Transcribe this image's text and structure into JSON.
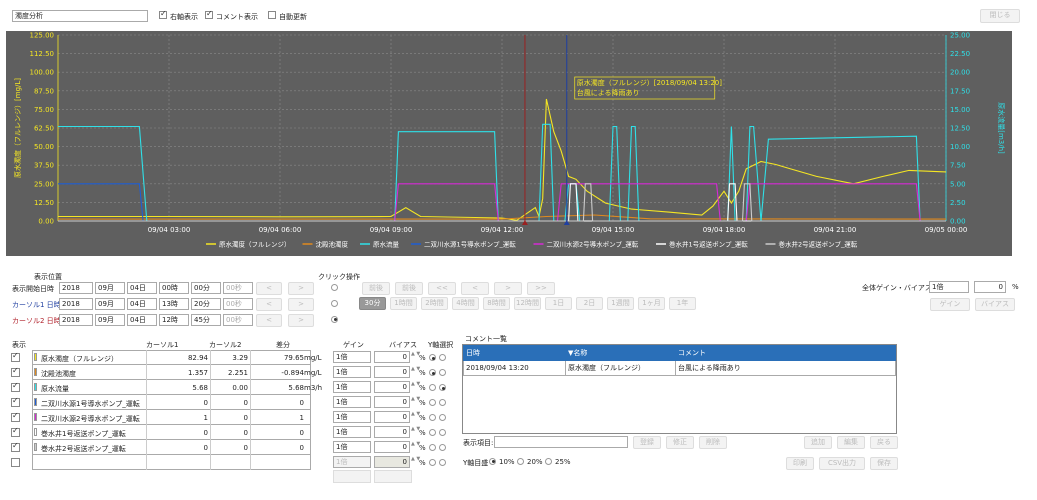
{
  "top": {
    "title_value": "濁度分析",
    "opt_right_axis": "右軸表示",
    "opt_comment": "コメント表示",
    "opt_autoupdate": "自動更新",
    "btn_close": "閉じる"
  },
  "chart_data": {
    "type": "line",
    "ylabel_left": "原水濁度（フルレンジ）[mg/L]",
    "ylabel_right": "原水流量[m3/h]",
    "y_left_ticks": [
      "125.00",
      "112.50",
      "100.00",
      "87.50",
      "75.00",
      "62.50",
      "50.00",
      "37.50",
      "25.00",
      "12.50",
      "0.00"
    ],
    "y_right_ticks": [
      "25.00",
      "22.50",
      "20.00",
      "17.50",
      "15.00",
      "12.50",
      "10.00",
      "7.50",
      "5.00",
      "2.50",
      "0.00"
    ],
    "ylim_left": [
      0,
      125
    ],
    "ylim_right": [
      0,
      25
    ],
    "x_ticks": [
      "09/04 03:00",
      "09/04 06:00",
      "09/04 09:00",
      "09/04 12:00",
      "09/04 15:00",
      "09/04 18:00",
      "09/04 21:00",
      "09/05 00:00"
    ],
    "xlim_hours": [
      0,
      24
    ],
    "annotation": {
      "line1": "原水濁度（フルレンジ）[2018/09/04 13:20]",
      "line2": "台風による降雨あり"
    },
    "cursor1_hour": 12.62,
    "cursor2_hour": 13.75,
    "series": [
      {
        "name": "原水濁度（フルレンジ）",
        "color": "#f5e623",
        "axis": "left",
        "points": [
          [
            0,
            3
          ],
          [
            3,
            3
          ],
          [
            6,
            2.8
          ],
          [
            8,
            2.9
          ],
          [
            9,
            3
          ],
          [
            9.4,
            9
          ],
          [
            9.8,
            3
          ],
          [
            12,
            2
          ],
          [
            12.4,
            0.5
          ],
          [
            12.9,
            9
          ],
          [
            13,
            3
          ],
          [
            13.1,
            15
          ],
          [
            13.2,
            82
          ],
          [
            13.4,
            60
          ],
          [
            13.6,
            47
          ],
          [
            13.8,
            30
          ],
          [
            14,
            28
          ],
          [
            14.3,
            20
          ],
          [
            14.8,
            12
          ],
          [
            15.5,
            8
          ],
          [
            16.5,
            6
          ],
          [
            17.4,
            4
          ],
          [
            17.7,
            10
          ],
          [
            18,
            20
          ],
          [
            18.2,
            12
          ],
          [
            18.4,
            20
          ],
          [
            18.6,
            35
          ],
          [
            19,
            40
          ],
          [
            19.4,
            38
          ],
          [
            19.8,
            35
          ],
          [
            20.5,
            30
          ],
          [
            21.5,
            25
          ],
          [
            22.3,
            30
          ],
          [
            23,
            34
          ],
          [
            24,
            33
          ]
        ]
      },
      {
        "name": "沈殿池濁度",
        "color": "#e08a1e",
        "axis": "left",
        "points": [
          [
            0,
            1.3
          ],
          [
            12,
            1.3
          ],
          [
            13.2,
            3
          ],
          [
            14.5,
            4
          ],
          [
            16,
            1.5
          ],
          [
            24,
            1.3
          ]
        ]
      },
      {
        "name": "原水流量",
        "color": "#2fe0e8",
        "axis": "right",
        "points": [
          [
            0,
            12.7
          ],
          [
            2.2,
            12.7
          ],
          [
            2.4,
            0
          ],
          [
            9.1,
            0
          ],
          [
            9.2,
            12
          ],
          [
            11.8,
            12
          ],
          [
            11.9,
            0
          ],
          [
            13,
            0
          ],
          [
            13.1,
            13
          ],
          [
            13.3,
            13
          ],
          [
            13.4,
            0
          ],
          [
            13.7,
            0
          ],
          [
            13.8,
            5
          ],
          [
            14,
            5
          ],
          [
            14.1,
            0
          ],
          [
            14.9,
            0
          ],
          [
            15,
            12.7
          ],
          [
            15.1,
            12.7
          ],
          [
            15.2,
            0
          ],
          [
            15.4,
            0
          ],
          [
            15.5,
            12.7
          ],
          [
            15.6,
            12.7
          ],
          [
            15.7,
            0
          ],
          [
            18.1,
            0
          ],
          [
            18.2,
            12.7
          ],
          [
            18.3,
            0
          ],
          [
            18.6,
            0
          ],
          [
            18.7,
            12.7
          ],
          [
            18.8,
            12.7
          ],
          [
            19,
            0
          ],
          [
            19.2,
            11
          ],
          [
            23.2,
            11.4
          ],
          [
            23.3,
            0
          ],
          [
            24,
            0
          ]
        ]
      },
      {
        "name": "二双川水源1号導水ポンプ_運転",
        "color": "#1f5fd4",
        "axis": "left",
        "points": [
          [
            0,
            25
          ],
          [
            2.2,
            25
          ],
          [
            2.3,
            0
          ],
          [
            24,
            0
          ]
        ]
      },
      {
        "name": "二双川水源2号導水ポンプ_運転",
        "color": "#d62ad6",
        "axis": "left",
        "points": [
          [
            0,
            0
          ],
          [
            9.1,
            0
          ],
          [
            9.2,
            25
          ],
          [
            11.8,
            25
          ],
          [
            11.9,
            0
          ],
          [
            13.5,
            0
          ],
          [
            13.6,
            25
          ],
          [
            17.8,
            25
          ],
          [
            17.9,
            0
          ],
          [
            18.6,
            0
          ],
          [
            18.7,
            25
          ],
          [
            23.2,
            25
          ],
          [
            23.3,
            0
          ],
          [
            24,
            0
          ]
        ]
      },
      {
        "name": "巻水井1号返送ポンプ_運転",
        "color": "#ffffff",
        "axis": "left",
        "points": [
          [
            0,
            0
          ],
          [
            13.8,
            0
          ],
          [
            13.85,
            25
          ],
          [
            14,
            25
          ],
          [
            14.05,
            0
          ],
          [
            18.1,
            0
          ],
          [
            18.15,
            25
          ],
          [
            18.3,
            25
          ],
          [
            18.35,
            0
          ],
          [
            24,
            0
          ]
        ]
      },
      {
        "name": "巻水井2号返送ポンプ_運転",
        "color": "#cccccc",
        "axis": "left",
        "points": [
          [
            0,
            0
          ],
          [
            14.2,
            0
          ],
          [
            14.25,
            25
          ],
          [
            14.4,
            25
          ],
          [
            14.45,
            0
          ],
          [
            18.5,
            0
          ],
          [
            18.55,
            25
          ],
          [
            18.7,
            25
          ],
          [
            18.75,
            0
          ],
          [
            24,
            0
          ]
        ]
      }
    ]
  },
  "controls": {
    "pos_label": "表示位置",
    "click_label": "クリック操作",
    "start_label": "表示開始日時",
    "cursor1_label": "カーソル1 日時",
    "cursor2_label": "カーソル2 日時",
    "start": [
      "2018",
      "09月",
      "04日",
      "00時",
      "00分",
      "00秒"
    ],
    "cursor1": [
      "2018",
      "09月",
      "04日",
      "13時",
      "20分",
      "00秒"
    ],
    "cursor2": [
      "2018",
      "09月",
      "04日",
      "12時",
      "45分",
      "00秒"
    ],
    "gain_bias_label": "全体ゲイン・バイアス",
    "gain_value": "1倍",
    "bias_value": "0",
    "pct": "%",
    "step_buttons": [
      "前後",
      "前後",
      "<<",
      "<",
      ">",
      ">>"
    ],
    "range_buttons": [
      "30分",
      "1時間",
      "2時間",
      "4時間",
      "8時間",
      "12時間",
      "1日",
      "2日",
      "1週間",
      "1ヶ月",
      "1年"
    ],
    "right_buttons": [
      "ゲイン",
      "バイアス"
    ]
  },
  "table": {
    "headers": {
      "display": "表示",
      "c1": "カーソル1",
      "c2": "カーソル2",
      "diff": "差分",
      "gain": "ゲイン",
      "bias": "バイアス",
      "yaxis": "Y軸選択"
    },
    "rows": [
      {
        "checked": true,
        "name": "原水濁度（フルレンジ）",
        "color": "#f5e623",
        "c1": "82.94",
        "c2": "3.29",
        "diff": "79.65",
        "unit": "mg/L",
        "gain": "1倍",
        "bias": "0",
        "y": "left"
      },
      {
        "checked": true,
        "name": "沈殿池濁度",
        "color": "#e08a1e",
        "c1": "1.357",
        "c2": "2.251",
        "diff": "-0.894",
        "unit": "mg/L",
        "gain": "1倍",
        "bias": "0",
        "y": "left"
      },
      {
        "checked": true,
        "name": "原水流量",
        "color": "#2fe0e8",
        "c1": "5.68",
        "c2": "0.00",
        "diff": "5.68",
        "unit": "m3/h",
        "gain": "1倍",
        "bias": "0",
        "y": "right"
      },
      {
        "checked": true,
        "name": "二双川水源1号導水ポンプ_運転",
        "color": "#1f5fd4",
        "c1": "0",
        "c2": "0",
        "diff": "0",
        "unit": "",
        "gain": "1倍",
        "bias": "0",
        "y": "none"
      },
      {
        "checked": true,
        "name": "二双川水源2号導水ポンプ_運転",
        "color": "#d62ad6",
        "c1": "1",
        "c2": "0",
        "diff": "1",
        "unit": "",
        "gain": "1倍",
        "bias": "0",
        "y": "none"
      },
      {
        "checked": true,
        "name": "巻水井1号返送ポンプ_運転",
        "color": "#ffffff",
        "c1": "0",
        "c2": "0",
        "diff": "0",
        "unit": "",
        "gain": "1倍",
        "bias": "0",
        "y": "none"
      },
      {
        "checked": true,
        "name": "巻水井2号返送ポンプ_運転",
        "color": "#cccccc",
        "c1": "0",
        "c2": "0",
        "diff": "0",
        "unit": "",
        "gain": "1倍",
        "bias": "0",
        "y": "none"
      },
      {
        "checked": false,
        "name": "",
        "color": "",
        "c1": "",
        "c2": "",
        "diff": "",
        "unit": "",
        "gain": "1倍",
        "bias": "0",
        "y": "none"
      }
    ]
  },
  "comments": {
    "title": "コメント一覧",
    "col_date": "日時",
    "col_name": "▼名称",
    "col_comment": "コメント",
    "rows": [
      {
        "date": "2018/09/04 13:20",
        "name": "原水濁度（フルレンジ）",
        "comment": "台風による降雨あり"
      }
    ],
    "item_label": "表示項目:",
    "btn_a": "登録",
    "btn_b": "修正",
    "btn_c": "削除",
    "btn_d": "追加",
    "btn_e": "編集",
    "btn_f": "戻る",
    "y_margin_label": "Y軸目盛",
    "y_margin_opts": [
      "10%",
      "20%",
      "25%"
    ],
    "btn_g": "印刷",
    "btn_h": "CSV出力",
    "btn_i": "保存"
  }
}
